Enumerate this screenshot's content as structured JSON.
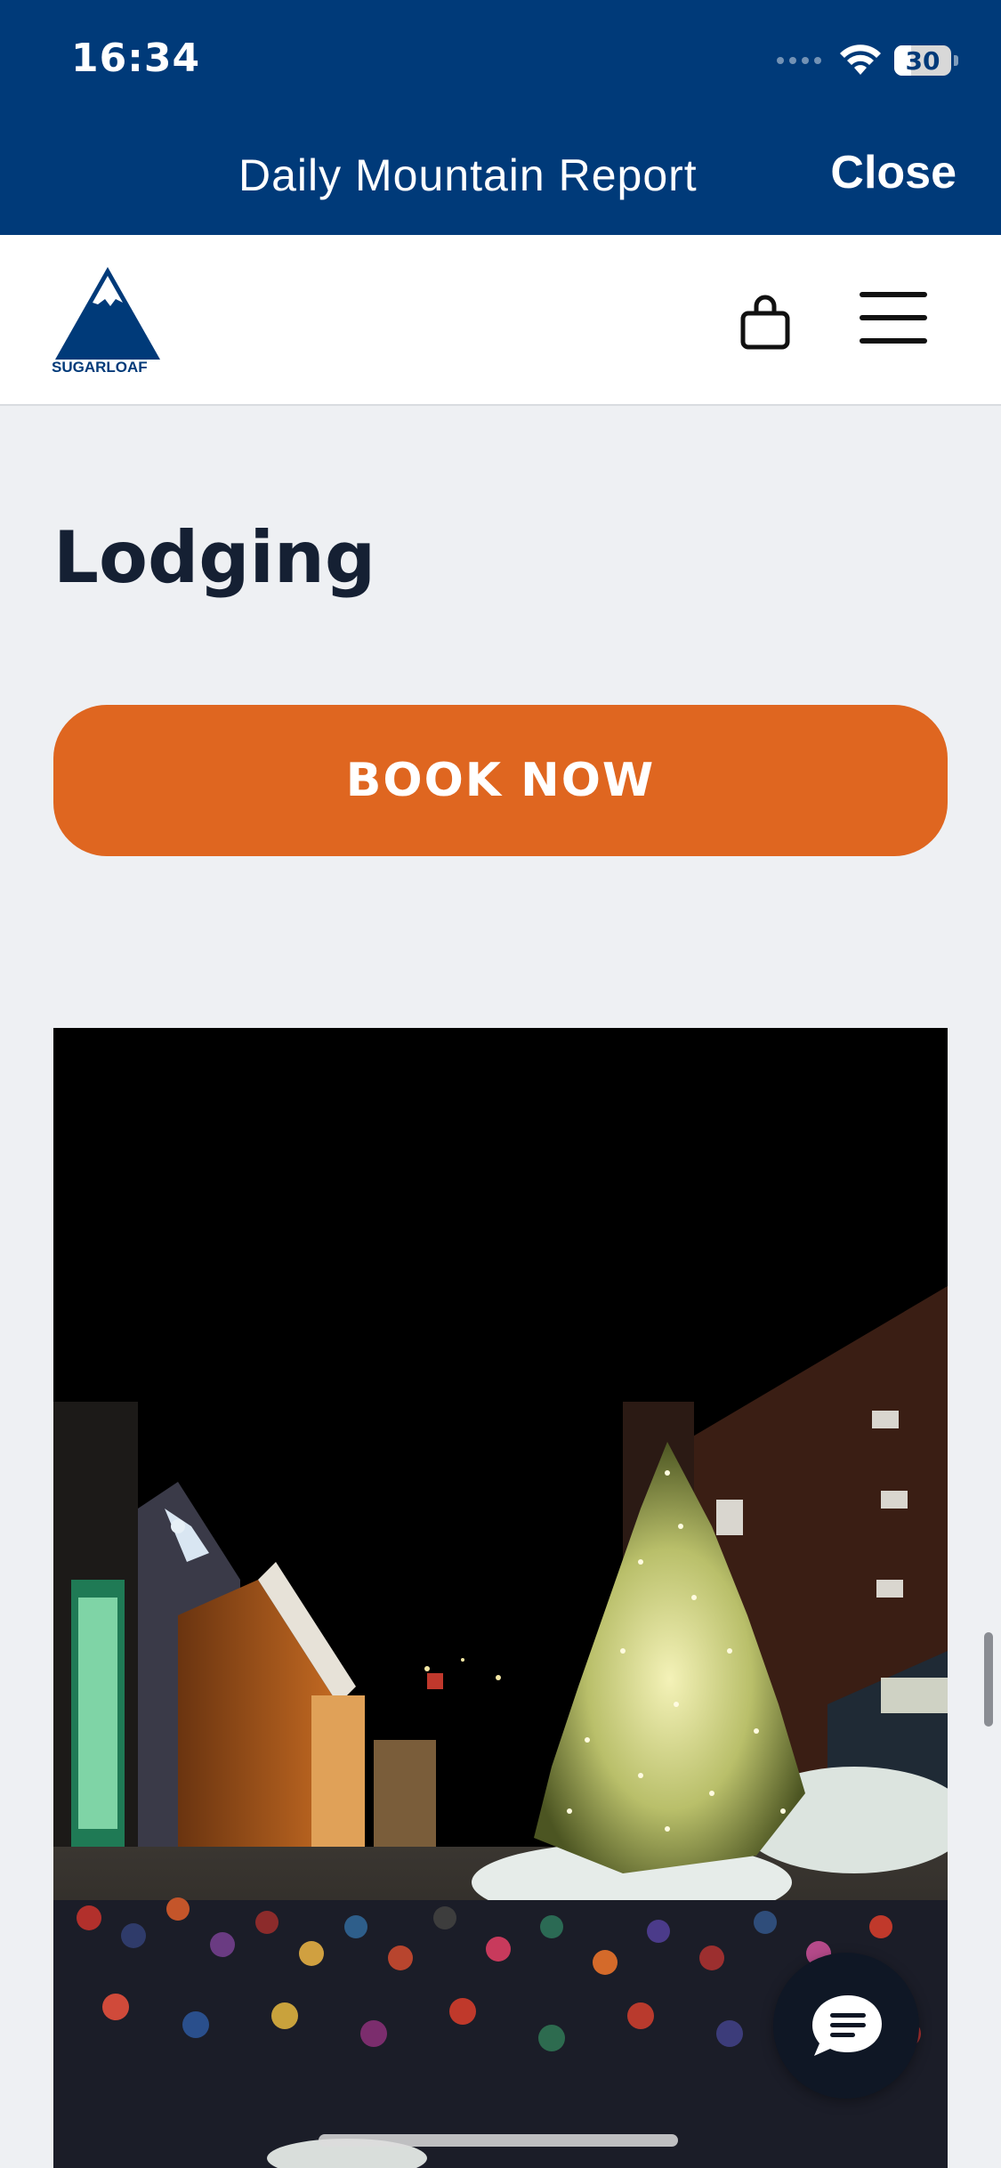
{
  "status_bar": {
    "time": "16:34",
    "battery": "30",
    "battery_fraction": 0.3
  },
  "webview": {
    "title": "Daily Mountain Report",
    "close_label": "Close"
  },
  "site_header": {
    "logo_text": "SUGARLOAF",
    "icons": [
      "sugarloaf-logo",
      "shopping-bag-icon",
      "menu-icon"
    ]
  },
  "content": {
    "title": "Lodging",
    "book_button_label": "BOOK NOW"
  },
  "floating": {
    "chat_icon": "chat-bubble-icon"
  },
  "colors": {
    "header_bg": "#003a79",
    "accent_orange": "#df6620",
    "page_bg": "#eef0f3",
    "title_text": "#152033",
    "chat_bg": "#0f1725"
  }
}
